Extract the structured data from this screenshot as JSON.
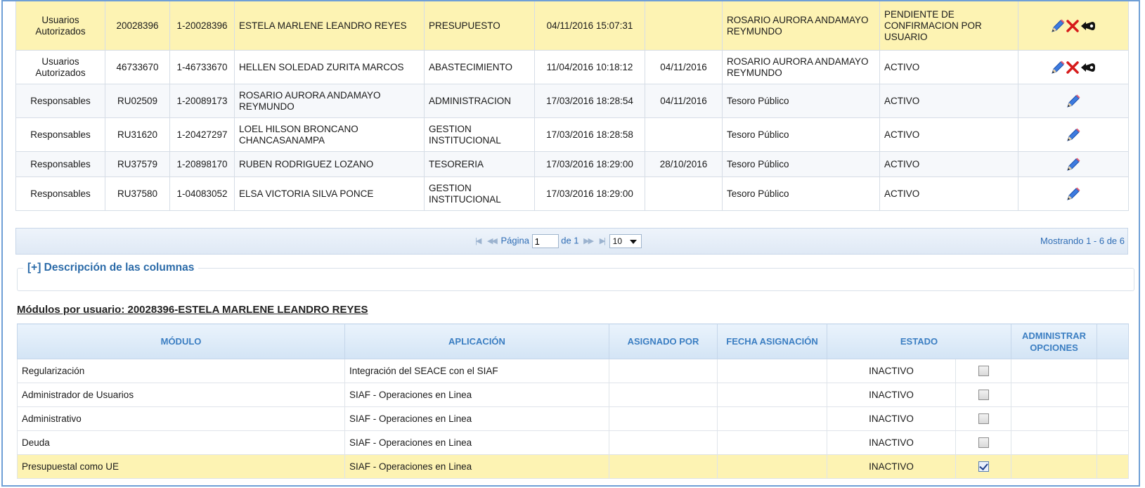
{
  "users": {
    "rows": [
      {
        "type": "Usuarios Autorizados",
        "code": "20028396",
        "id": "1-20028396",
        "name": "ESTELA MARLENE LEANDRO REYES",
        "area": "PRESUPUESTO",
        "created": "04/11/2016 15:07:31",
        "date2": "",
        "authorized_by": "ROSARIO AURORA ANDAMAYO REYMUNDO",
        "status": "PENDIENTE DE CONFIRMACION POR USUARIO",
        "actions": [
          "pencil",
          "delete",
          "unlock"
        ],
        "selected": true
      },
      {
        "type": "Usuarios Autorizados",
        "code": "46733670",
        "id": "1-46733670",
        "name": "HELLEN SOLEDAD ZURITA MARCOS",
        "area": "ABASTECIMIENTO",
        "created": "11/04/2016 10:18:12",
        "date2": "04/11/2016",
        "authorized_by": "ROSARIO AURORA ANDAMAYO REYMUNDO",
        "status": "ACTIVO",
        "actions": [
          "pencil",
          "delete",
          "unlock"
        ],
        "selected": false
      },
      {
        "type": "Responsables",
        "code": "RU02509",
        "id": "1-20089173",
        "name": "ROSARIO AURORA ANDAMAYO REYMUNDO",
        "area": "ADMINISTRACION",
        "created": "17/03/2016 18:28:54",
        "date2": "04/11/2016",
        "authorized_by": "Tesoro Público",
        "status": "ACTIVO",
        "actions": [
          "pencil"
        ],
        "selected": false
      },
      {
        "type": "Responsables",
        "code": "RU31620",
        "id": "1-20427297",
        "name": "LOEL HILSON BRONCANO CHANCASANAMPA",
        "area": "GESTION INSTITUCIONAL",
        "created": "17/03/2016 18:28:58",
        "date2": "",
        "authorized_by": "Tesoro Público",
        "status": "ACTIVO",
        "actions": [
          "pencil"
        ],
        "selected": false
      },
      {
        "type": "Responsables",
        "code": "RU37579",
        "id": "1-20898170",
        "name": "RUBEN RODRIGUEZ LOZANO",
        "area": "TESORERIA",
        "created": "17/03/2016 18:29:00",
        "date2": "28/10/2016",
        "authorized_by": "Tesoro Público",
        "status": "ACTIVO",
        "actions": [
          "pencil"
        ],
        "selected": false
      },
      {
        "type": "Responsables",
        "code": "RU37580",
        "id": "1-04083052",
        "name": "ELSA VICTORIA SILVA PONCE",
        "area": "GESTION INSTITUCIONAL",
        "created": "17/03/2016 18:29:00",
        "date2": "",
        "authorized_by": "Tesoro Público",
        "status": "ACTIVO",
        "actions": [
          "pencil"
        ],
        "selected": false
      }
    ]
  },
  "pager": {
    "first_icon": "first-page-icon",
    "prev_icon": "prev-page-icon",
    "next_icon": "next-page-icon",
    "last_icon": "last-page-icon",
    "page_label": "Página",
    "page_value": "1",
    "of_label": "de 1",
    "page_size": "10",
    "showing": "Mostrando 1 - 6 de 6"
  },
  "description": {
    "toggle_label": "[+] Descripción de las columnas"
  },
  "modules": {
    "title": "Módulos por usuario: 20028396-ESTELA MARLENE LEANDRO REYES",
    "headers": {
      "module": "MÓDULO",
      "application": "APLICACIÓN",
      "assigned_by": "ASIGNADO POR",
      "assigned_date": "FECHA ASIGNACIÓN",
      "status": "ESTADO",
      "admin": "ADMINISTRAR OPCIONES"
    },
    "rows": [
      {
        "module": "Regularización",
        "application": "Integración del SEACE con el SIAF",
        "assigned_by": "",
        "assigned_date": "",
        "status": "INACTIVO",
        "checked": false,
        "selected": false
      },
      {
        "module": "Administrador de Usuarios",
        "application": "SIAF - Operaciones en Linea",
        "assigned_by": "",
        "assigned_date": "",
        "status": "INACTIVO",
        "checked": false,
        "selected": false
      },
      {
        "module": "Administrativo",
        "application": "SIAF - Operaciones en Linea",
        "assigned_by": "",
        "assigned_date": "",
        "status": "INACTIVO",
        "checked": false,
        "selected": false
      },
      {
        "module": "Deuda",
        "application": "SIAF - Operaciones en Linea",
        "assigned_by": "",
        "assigned_date": "",
        "status": "INACTIVO",
        "checked": false,
        "selected": false
      },
      {
        "module": "Presupuestal como UE",
        "application": "SIAF - Operaciones en Linea",
        "assigned_by": "",
        "assigned_date": "",
        "status": "INACTIVO",
        "checked": true,
        "selected": true
      }
    ]
  },
  "colors": {
    "selected_row": "#fdf3b3",
    "link_blue": "#2f6db5",
    "header_blue": "#3b7ec2",
    "delete_red": "#d61a1a"
  }
}
